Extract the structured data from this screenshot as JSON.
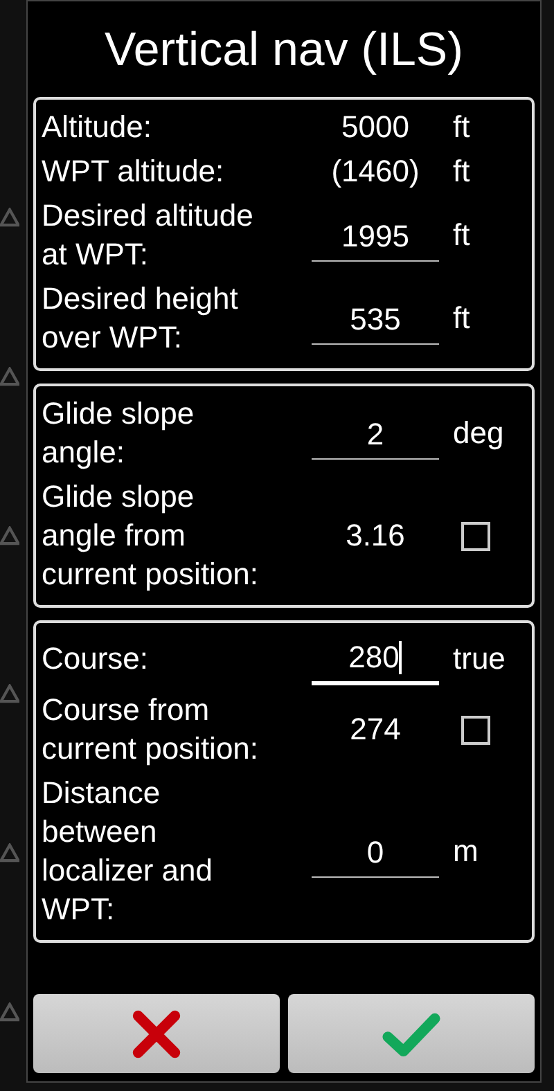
{
  "dialog": {
    "title": "Vertical nav (ILS)",
    "sections": [
      {
        "rows": [
          {
            "kind": "text",
            "label": "Altitude:",
            "value": "5000",
            "unit": "ft"
          },
          {
            "kind": "text",
            "label": "WPT altitude:",
            "value": "(1460)",
            "unit": "ft"
          },
          {
            "kind": "field",
            "label": "Desired altitude\nat WPT:",
            "value": "1995",
            "unit": "ft",
            "focused": false
          },
          {
            "kind": "field",
            "label": "Desired height\nover WPT:",
            "value": "535",
            "unit": "ft",
            "focused": false
          }
        ]
      },
      {
        "rows": [
          {
            "kind": "field",
            "label": "Glide slope\nangle:",
            "value": "2",
            "unit": "deg",
            "focused": false
          },
          {
            "kind": "checkbox",
            "label": "Glide slope\nangle from\ncurrent position:",
            "value": "3.16",
            "checked": false
          }
        ]
      },
      {
        "rows": [
          {
            "kind": "field",
            "label": "Course:",
            "value": "280",
            "unit": "true",
            "focused": true
          },
          {
            "kind": "checkbox",
            "label": "Course from\ncurrent position:",
            "value": "274",
            "checked": false
          },
          {
            "kind": "field",
            "label": "Distance\nbetween\nlocalizer and\nWPT:",
            "value": "0",
            "unit": "m",
            "focused": false
          }
        ]
      }
    ],
    "buttons": [
      {
        "kind": "cancel"
      },
      {
        "kind": "ok"
      }
    ]
  }
}
